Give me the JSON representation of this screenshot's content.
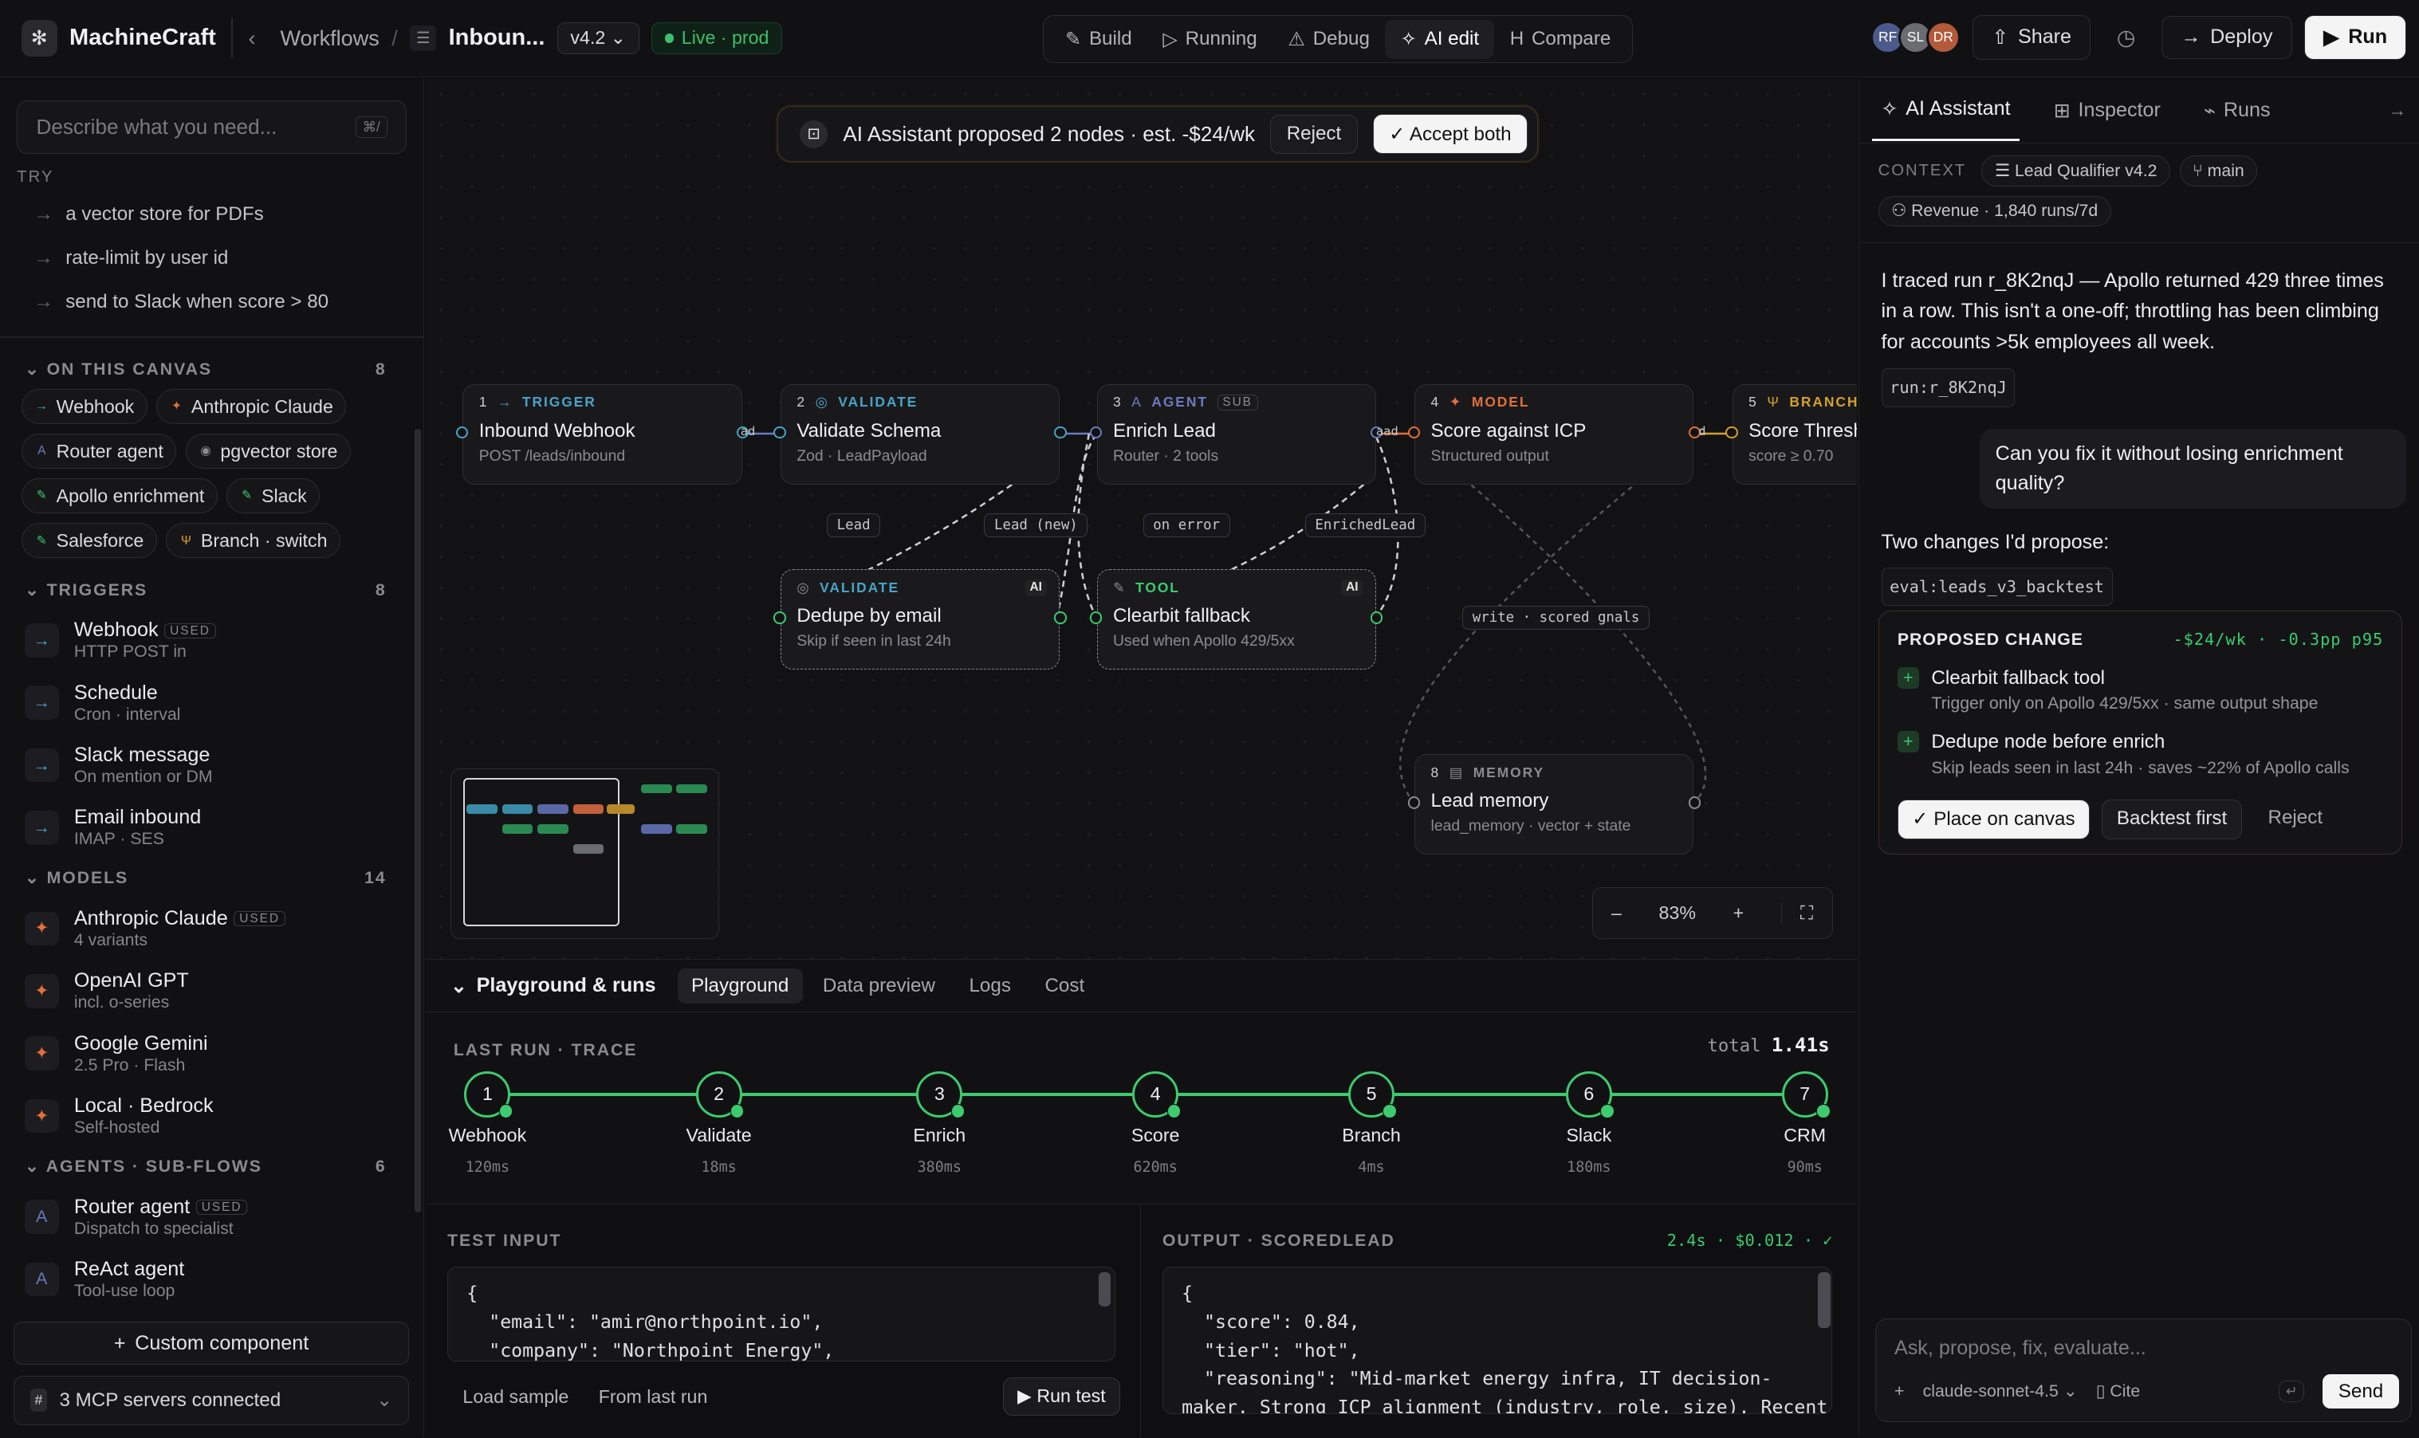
{
  "app": {
    "name": "MachineCraft"
  },
  "breadcrumb": {
    "root": "Workflows",
    "sep": "/",
    "current": "Inboun...",
    "version": "v4.2 ⌄",
    "status": "Live · prod"
  },
  "modes": [
    {
      "label": "Build",
      "icon": "✎"
    },
    {
      "label": "Running",
      "icon": "▷"
    },
    {
      "label": "Debug",
      "icon": "⚠"
    },
    {
      "label": "AI edit",
      "icon": "✧"
    },
    {
      "label": "Compare",
      "icon": "H"
    }
  ],
  "avatars": [
    {
      "initials": "RF",
      "color": "#4b5a8a"
    },
    {
      "initials": "SL",
      "color": "#6b6b72"
    },
    {
      "initials": "DR",
      "color": "#b35a3a"
    }
  ],
  "topbar": {
    "share": "Share",
    "deploy": "Deploy",
    "run": "Run"
  },
  "left": {
    "search_placeholder": "Describe what you need...",
    "search_kbd": "⌘/",
    "try_label": "TRY",
    "try_items": [
      "a vector store for PDFs",
      "rate-limit by user id",
      "send to Slack when score > 80"
    ],
    "canvas_section": {
      "title": "ON THIS CANVAS",
      "count": "8",
      "chips": [
        {
          "label": "Webhook",
          "color": "#4aa3c7",
          "icon": "→"
        },
        {
          "label": "Anthropic Claude",
          "color": "#e0703a",
          "icon": "✦"
        },
        {
          "label": "Router agent",
          "color": "#6b7bbd",
          "icon": "A"
        },
        {
          "label": "pgvector store",
          "color": "#8a8a90",
          "icon": "◉"
        },
        {
          "label": "Apollo enrichment",
          "color": "#3ccb6e",
          "icon": "✎"
        },
        {
          "label": "Slack",
          "color": "#3ccb6e",
          "icon": "✎"
        },
        {
          "label": "Salesforce",
          "color": "#3ccb6e",
          "icon": "✎"
        },
        {
          "label": "Branch · switch",
          "color": "#d4a02a",
          "icon": "Ψ"
        }
      ]
    },
    "triggers": {
      "title": "TRIGGERS",
      "count": "8",
      "items": [
        {
          "title": "Webhook",
          "sub": "HTTP POST in",
          "used": "USED"
        },
        {
          "title": "Schedule",
          "sub": "Cron · interval",
          "used": ""
        },
        {
          "title": "Slack message",
          "sub": "On mention or DM",
          "used": ""
        },
        {
          "title": "Email inbound",
          "sub": "IMAP · SES",
          "used": ""
        }
      ]
    },
    "models": {
      "title": "MODELS",
      "count": "14",
      "items": [
        {
          "title": "Anthropic Claude",
          "sub": "4 variants",
          "used": "USED"
        },
        {
          "title": "OpenAI GPT",
          "sub": "incl. o-series",
          "used": ""
        },
        {
          "title": "Google Gemini",
          "sub": "2.5 Pro · Flash",
          "used": ""
        },
        {
          "title": "Local · Bedrock",
          "sub": "Self-hosted",
          "used": ""
        }
      ]
    },
    "agents": {
      "title": "AGENTS · SUB-FLOWS",
      "count": "6",
      "items": [
        {
          "title": "Router agent",
          "sub": "Dispatch to specialist",
          "used": "USED"
        },
        {
          "title": "ReAct agent",
          "sub": "Tool-use loop",
          "used": ""
        }
      ]
    },
    "custom": "Custom component",
    "mcp": "3 MCP servers connected"
  },
  "canvas": {
    "banner": {
      "text": "AI Assistant proposed 2 nodes · est. -$24/wk",
      "reject": "Reject",
      "accept": "Accept both"
    },
    "nodes": [
      {
        "num": "1",
        "kind": "TRIGGER",
        "title": "Inbound Webhook",
        "sub": "POST /leads/inbound",
        "color": "#4aa3c7",
        "icon": "→"
      },
      {
        "num": "2",
        "kind": "VALIDATE",
        "title": "Validate Schema",
        "sub": "Zod · LeadPayload",
        "color": "#4aa3c7",
        "icon": "◎"
      },
      {
        "num": "3",
        "kind": "AGENT",
        "title": "Enrich Lead",
        "sub": "Router · 2 tools",
        "color": "#6b7bbd",
        "icon": "A",
        "tag": "SUB"
      },
      {
        "num": "4",
        "kind": "MODEL",
        "title": "Score against ICP",
        "sub": "Structured output",
        "color": "#e0703a",
        "icon": "✦"
      },
      {
        "num": "5",
        "kind": "BRANCH",
        "title": "Score Threshold",
        "sub": "score ≥ 0.70",
        "color": "#d4a02a",
        "icon": "Ψ"
      },
      {
        "num": "8",
        "kind": "MEMORY",
        "title": "Lead memory",
        "sub": "lead_memory · vector + state",
        "color": "#8a8a90",
        "icon": "▤"
      }
    ],
    "ai_nodes": [
      {
        "kind": "VALIDATE",
        "title": "Dedupe by email",
        "sub": "Skip if seen in last 24h",
        "tag": "AI"
      },
      {
        "kind": "TOOL",
        "title": "Clearbit fallback",
        "sub": "Used when Apollo 429/5xx",
        "tag": "AI"
      }
    ],
    "edge_labels": [
      "Lead",
      "Lead (new)",
      "on error",
      "EnrichedLead",
      "write · scored gnals",
      "ad",
      "aad",
      "d"
    ],
    "zoom": "83%"
  },
  "play": {
    "title": "Playground & runs",
    "tabs": [
      "Playground",
      "Data preview",
      "Logs",
      "Cost"
    ],
    "trace_label": "LAST RUN · TRACE",
    "total_label": "total",
    "total": "1.41s",
    "steps": [
      {
        "n": "1",
        "name": "Webhook",
        "t": "120ms"
      },
      {
        "n": "2",
        "name": "Validate",
        "t": "18ms"
      },
      {
        "n": "3",
        "name": "Enrich",
        "t": "380ms"
      },
      {
        "n": "4",
        "name": "Score",
        "t": "620ms"
      },
      {
        "n": "5",
        "name": "Branch",
        "t": "4ms"
      },
      {
        "n": "6",
        "name": "Slack",
        "t": "180ms"
      },
      {
        "n": "7",
        "name": "CRM",
        "t": "90ms"
      }
    ],
    "input": {
      "title": "TEST INPUT",
      "code": "{\n  \"email\": \"amir@northpoint.io\",\n  \"company\": \"Northpoint Energy\",",
      "load": "Load sample",
      "from": "From last run",
      "run": "Run test"
    },
    "output": {
      "title": "OUTPUT · SCOREDLEAD",
      "stats": "2.4s · $0.012 · ✓",
      "code": "{\n  \"score\": 0.84,\n  \"tier\": \"hot\",\n  \"reasoning\": \"Mid-market energy infra, IT decision-\nmaker. Strong ICP alignment (industry, role, size). Recent"
    }
  },
  "right": {
    "tabs": [
      "AI Assistant",
      "Inspector",
      "Runs"
    ],
    "ctx_label": "CONTEXT",
    "ctx": [
      "Lead Qualifier v4.2",
      "main",
      "Revenue · 1,840 runs/7d"
    ],
    "msg1": "I traced run r_8K2nqJ — Apollo returned 429 three times in a row. This isn't a one-off; throttling has been climbing for accounts >5k employees all week.",
    "ref1": "run:r_8K2nqJ",
    "user": "Can you fix it without losing enrichment quality?",
    "msg2": "Two changes I'd propose:",
    "ref2": "eval:leads_v3_backtest",
    "proposal": {
      "title": "PROPOSED CHANGE",
      "cost": "-$24/wk · -0.3pp p95",
      "items": [
        {
          "t": "Clearbit fallback tool",
          "s": "Trigger only on Apollo 429/5xx · same output shape"
        },
        {
          "t": "Dedupe node before enrich",
          "s": "Skip leads seen in last 24h · saves ~22% of Apollo calls"
        }
      ],
      "place": "Place on canvas",
      "backtest": "Backtest first",
      "reject": "Reject"
    },
    "ask_placeholder": "Ask, propose, fix, evaluate...",
    "model": "claude-sonnet-4.5",
    "cite": "Cite",
    "send": "Send"
  }
}
